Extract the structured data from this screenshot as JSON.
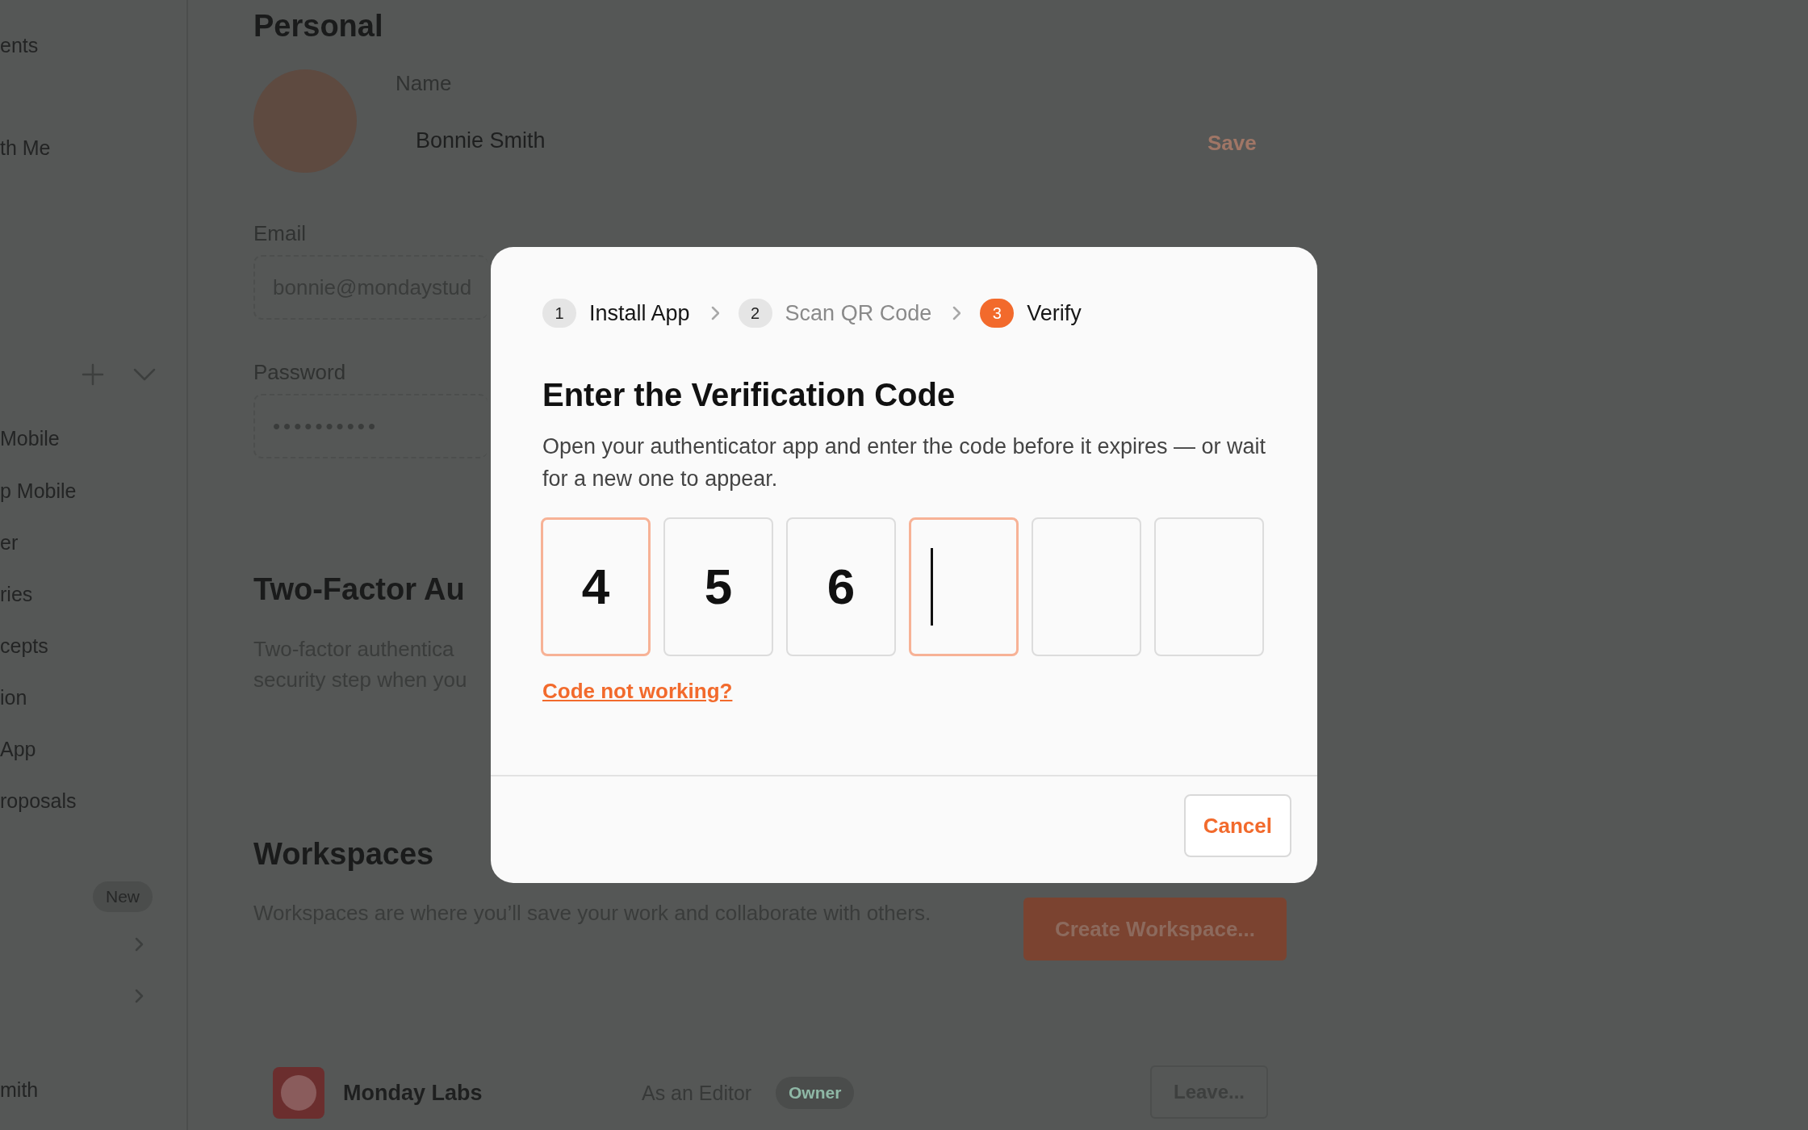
{
  "sidebar": {
    "items": [
      {
        "kind": "link",
        "label": "ents"
      },
      {
        "kind": "link",
        "label": "th Me"
      },
      {
        "kind": "actions"
      },
      {
        "kind": "link",
        "label": "Mobile"
      },
      {
        "kind": "link",
        "label": "p Mobile"
      },
      {
        "kind": "link",
        "label": "er"
      },
      {
        "kind": "link",
        "label": "ries"
      },
      {
        "kind": "link",
        "label": "cepts"
      },
      {
        "kind": "link",
        "label": "ion"
      },
      {
        "kind": "link",
        "label": "App"
      },
      {
        "kind": "link",
        "label": "roposals"
      },
      {
        "kind": "badge",
        "badge": "New"
      },
      {
        "kind": "expander"
      },
      {
        "kind": "expander"
      }
    ],
    "user": "mith"
  },
  "personal": {
    "title": "Personal",
    "name_label": "Name",
    "name_value": "Bonnie Smith",
    "save": "Save",
    "email_label": "Email",
    "email_value": "bonnie@mondaystud",
    "password_label": "Password",
    "password_value": "••••••••••"
  },
  "two_factor": {
    "title": "Two-Factor Au",
    "text": [
      "Two-factor authentica",
      "security step when you"
    ]
  },
  "workspaces": {
    "title": "Workspaces",
    "text": "Workspaces are where you’ll save your work and collaborate with others.",
    "create": "Create Workspace...",
    "rows": [
      {
        "name": "Monday Labs",
        "role": "As an Editor",
        "badge": "Owner",
        "action": "Leave..."
      }
    ]
  },
  "dialog": {
    "steps": [
      {
        "number": "1",
        "label": "Install App",
        "selected": false,
        "dimmed": false
      },
      {
        "number": "2",
        "label": "Scan QR Code",
        "selected": false,
        "dimmed": true
      },
      {
        "number": "3",
        "label": "Verify",
        "selected": true,
        "dimmed": false
      }
    ],
    "title": "Enter the Verification Code",
    "text": "Open your authenticator app and enter the code before it expires — or wait for a new one to appear.",
    "code": [
      {
        "value": "4",
        "highlighted": true,
        "caret": false
      },
      {
        "value": "5",
        "highlighted": false,
        "caret": false
      },
      {
        "value": "6",
        "highlighted": false,
        "caret": false
      },
      {
        "highlighted": true,
        "caret": true
      },
      {
        "highlighted": false,
        "caret": false
      },
      {
        "highlighted": false,
        "caret": false
      }
    ],
    "help_link": "Code not working?",
    "cancel": "Cancel"
  }
}
